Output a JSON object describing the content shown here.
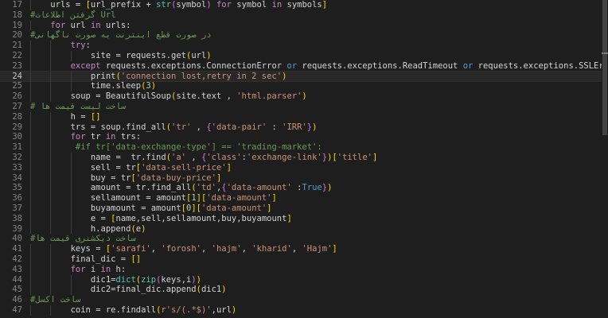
{
  "colors": {
    "background": "#1e1e1e",
    "default": "#d4d4d4",
    "keyword": "#c586c0",
    "string": "#ce9178",
    "function": "#dcdcaa",
    "variable": "#9cdcfe",
    "number": "#b5cea8",
    "comment": "#6a9955",
    "constant": "#569cd6",
    "class": "#4ec9b0",
    "bracket1": "#ffd700",
    "bracket2": "#da70d6",
    "bracket3": "#179fff",
    "line_number": "#858585"
  },
  "current_line": 24,
  "lines": [
    {
      "n": 17,
      "indent": 1,
      "tokens": [
        [
          "urls ",
          "d"
        ],
        [
          "= ",
          "d"
        ],
        [
          "[",
          "b1"
        ],
        [
          "url_prefix ",
          "d"
        ],
        [
          "+ ",
          "d"
        ],
        [
          "str",
          "c"
        ],
        [
          "(",
          "b2"
        ],
        [
          "symbol",
          "d"
        ],
        [
          ")",
          "b2"
        ],
        [
          " for ",
          "k"
        ],
        [
          "symbol ",
          "d"
        ],
        [
          "in ",
          "k"
        ],
        [
          "symbols",
          "d"
        ],
        [
          "]",
          "b1"
        ]
      ]
    },
    {
      "n": 18,
      "indent": 0,
      "tokens": [
        [
          "#گرفتن اطلاعات Url",
          "m"
        ]
      ]
    },
    {
      "n": 19,
      "indent": 1,
      "tokens": [
        [
          "for ",
          "k"
        ],
        [
          "url ",
          "d"
        ],
        [
          "in ",
          "k"
        ],
        [
          "urls",
          "d"
        ],
        [
          ":",
          "d"
        ]
      ]
    },
    {
      "n": 20,
      "indent": 0,
      "tokens": [
        [
          "#در صورت قطع اینترنت به صورت ناگهانی",
          "m"
        ]
      ]
    },
    {
      "n": 21,
      "indent": 2,
      "tokens": [
        [
          "try",
          "k"
        ],
        [
          ":",
          "d"
        ]
      ]
    },
    {
      "n": 22,
      "indent": 3,
      "tokens": [
        [
          "site ",
          "d"
        ],
        [
          "= ",
          "d"
        ],
        [
          "requests.get",
          "d"
        ],
        [
          "(",
          "b1"
        ],
        [
          "url",
          "d"
        ],
        [
          ")",
          "b1"
        ]
      ]
    },
    {
      "n": 23,
      "indent": 2,
      "tokens": [
        [
          "except ",
          "k"
        ],
        [
          "requests.exceptions.ConnectionError ",
          "d"
        ],
        [
          "or ",
          "o"
        ],
        [
          "requests.exceptions.ReadTimeout ",
          "d"
        ],
        [
          "or ",
          "o"
        ],
        [
          "requests.exceptions.SSLError",
          "d"
        ],
        [
          ":",
          "d"
        ]
      ]
    },
    {
      "n": 24,
      "indent": 3,
      "tokens": [
        [
          "print",
          "d"
        ],
        [
          "(",
          "b1"
        ],
        [
          "'connection lost,retry in 2 sec'",
          "s"
        ],
        [
          ")",
          "b1"
        ]
      ]
    },
    {
      "n": 25,
      "indent": 3,
      "tokens": [
        [
          "time.sleep",
          "d"
        ],
        [
          "(",
          "b1"
        ],
        [
          "3",
          "u"
        ],
        [
          ")",
          "b1"
        ]
      ]
    },
    {
      "n": 26,
      "indent": 2,
      "tokens": [
        [
          "soup ",
          "d"
        ],
        [
          "= ",
          "d"
        ],
        [
          "BeautifulSoup",
          "d"
        ],
        [
          "(",
          "b1"
        ],
        [
          "site.text ",
          "d"
        ],
        [
          ", ",
          "d"
        ],
        [
          "'html.parser'",
          "s"
        ],
        [
          ")",
          "b1"
        ]
      ]
    },
    {
      "n": 27,
      "indent": 0,
      "tokens": [
        [
          "# ساخت لیست قیمت ها",
          "m"
        ]
      ]
    },
    {
      "n": 28,
      "indent": 2,
      "tokens": [
        [
          "h ",
          "d"
        ],
        [
          "= ",
          "d"
        ],
        [
          "[]",
          "b1"
        ]
      ]
    },
    {
      "n": 29,
      "indent": 2,
      "tokens": [
        [
          "trs ",
          "d"
        ],
        [
          "= ",
          "d"
        ],
        [
          "soup.find_all",
          "d"
        ],
        [
          "(",
          "b1"
        ],
        [
          "'tr' ",
          "s"
        ],
        [
          ", ",
          "d"
        ],
        [
          "{",
          "b2"
        ],
        [
          "'data-pair' ",
          "s"
        ],
        [
          ": ",
          "d"
        ],
        [
          "'IRR'",
          "s"
        ],
        [
          "}",
          "b2"
        ],
        [
          ")",
          "b1"
        ]
      ]
    },
    {
      "n": 30,
      "indent": 2,
      "tokens": [
        [
          "for ",
          "k"
        ],
        [
          "tr ",
          "d"
        ],
        [
          "in ",
          "k"
        ],
        [
          "trs",
          "d"
        ],
        [
          ":",
          "d"
        ]
      ]
    },
    {
      "n": 31,
      "indent": 2,
      "pre": " ",
      "tokens": [
        [
          "#if tr['data-exchange-type'] == 'trading-market':",
          "m"
        ]
      ]
    },
    {
      "n": 32,
      "indent": 3,
      "tokens": [
        [
          "name ",
          "d"
        ],
        [
          "=  ",
          "d"
        ],
        [
          "tr.find",
          "d"
        ],
        [
          "(",
          "b1"
        ],
        [
          "'a' ",
          "s"
        ],
        [
          ", ",
          "d"
        ],
        [
          "{",
          "b2"
        ],
        [
          "'class'",
          "s"
        ],
        [
          ":",
          "d"
        ],
        [
          "'exchange-link'",
          "s"
        ],
        [
          "}",
          "b2"
        ],
        [
          ")",
          "b1"
        ],
        [
          "[",
          "b1"
        ],
        [
          "'title'",
          "s"
        ],
        [
          "]",
          "b1"
        ]
      ]
    },
    {
      "n": 33,
      "indent": 3,
      "tokens": [
        [
          "sell ",
          "d"
        ],
        [
          "= ",
          "d"
        ],
        [
          "tr",
          "d"
        ],
        [
          "[",
          "b1"
        ],
        [
          "'data-sell-price'",
          "s"
        ],
        [
          "]",
          "b1"
        ]
      ]
    },
    {
      "n": 34,
      "indent": 3,
      "tokens": [
        [
          "buy ",
          "d"
        ],
        [
          "= ",
          "d"
        ],
        [
          "tr",
          "d"
        ],
        [
          "[",
          "b1"
        ],
        [
          "'data-buy-price'",
          "s"
        ],
        [
          "]",
          "b1"
        ]
      ]
    },
    {
      "n": 35,
      "indent": 3,
      "tokens": [
        [
          "amount ",
          "d"
        ],
        [
          "= ",
          "d"
        ],
        [
          "tr.find_all",
          "d"
        ],
        [
          "(",
          "b1"
        ],
        [
          "'td'",
          "s"
        ],
        [
          ",",
          "d"
        ],
        [
          "{",
          "b2"
        ],
        [
          "'data-amount' ",
          "s"
        ],
        [
          ":",
          "d"
        ],
        [
          "True",
          "t"
        ],
        [
          "}",
          "b2"
        ],
        [
          ")",
          "b1"
        ]
      ]
    },
    {
      "n": 36,
      "indent": 3,
      "tokens": [
        [
          "sellamount ",
          "d"
        ],
        [
          "= ",
          "d"
        ],
        [
          "amount",
          "d"
        ],
        [
          "[",
          "b1"
        ],
        [
          "1",
          "u"
        ],
        [
          "]",
          "b1"
        ],
        [
          "[",
          "b1"
        ],
        [
          "'data-amount'",
          "s"
        ],
        [
          "]",
          "b1"
        ]
      ]
    },
    {
      "n": 37,
      "indent": 3,
      "tokens": [
        [
          "buyamount ",
          "d"
        ],
        [
          "= ",
          "d"
        ],
        [
          "amount",
          "d"
        ],
        [
          "[",
          "b1"
        ],
        [
          "0",
          "u"
        ],
        [
          "]",
          "b1"
        ],
        [
          "[",
          "b1"
        ],
        [
          "'data-amount'",
          "s"
        ],
        [
          "]",
          "b1"
        ]
      ]
    },
    {
      "n": 38,
      "indent": 3,
      "tokens": [
        [
          "e ",
          "d"
        ],
        [
          "= ",
          "d"
        ],
        [
          "[",
          "b1"
        ],
        [
          "name,sell,sellamount,buy,buyamount",
          "d"
        ],
        [
          "]",
          "b1"
        ]
      ]
    },
    {
      "n": 39,
      "indent": 3,
      "tokens": [
        [
          "h.append",
          "d"
        ],
        [
          "(",
          "b1"
        ],
        [
          "e",
          "d"
        ],
        [
          ")",
          "b1"
        ]
      ]
    },
    {
      "n": 40,
      "indent": 0,
      "tokens": [
        [
          "#ساخت دیکشنری قیمت ها",
          "m"
        ]
      ]
    },
    {
      "n": 41,
      "indent": 2,
      "tokens": [
        [
          "keys ",
          "d"
        ],
        [
          "= ",
          "d"
        ],
        [
          "[",
          "b1"
        ],
        [
          "'sarafi'",
          "s"
        ],
        [
          ", ",
          "d"
        ],
        [
          "'forosh'",
          "s"
        ],
        [
          ", ",
          "d"
        ],
        [
          "'hajm'",
          "s"
        ],
        [
          ", ",
          "d"
        ],
        [
          "'kharid'",
          "s"
        ],
        [
          ", ",
          "d"
        ],
        [
          "'Hajm'",
          "s"
        ],
        [
          "]",
          "b1"
        ]
      ]
    },
    {
      "n": 42,
      "indent": 2,
      "tokens": [
        [
          "final_dic ",
          "d"
        ],
        [
          "= ",
          "d"
        ],
        [
          "[]",
          "b1"
        ]
      ]
    },
    {
      "n": 43,
      "indent": 2,
      "tokens": [
        [
          "for ",
          "k"
        ],
        [
          "i ",
          "d"
        ],
        [
          "in ",
          "k"
        ],
        [
          "h",
          "d"
        ],
        [
          ":",
          "d"
        ]
      ]
    },
    {
      "n": 44,
      "indent": 3,
      "tokens": [
        [
          "dic1",
          "d"
        ],
        [
          "=",
          "d"
        ],
        [
          "dict",
          "c"
        ],
        [
          "(",
          "b1"
        ],
        [
          "zip",
          "c"
        ],
        [
          "(",
          "b2"
        ],
        [
          "keys,i",
          "d"
        ],
        [
          ")",
          "b2"
        ],
        [
          ")",
          "b1"
        ]
      ]
    },
    {
      "n": 45,
      "indent": 3,
      "tokens": [
        [
          "dic2",
          "d"
        ],
        [
          "=",
          "d"
        ],
        [
          "final_dic.append",
          "d"
        ],
        [
          "(",
          "b1"
        ],
        [
          "dic1",
          "d"
        ],
        [
          ")",
          "b1"
        ]
      ]
    },
    {
      "n": 46,
      "indent": 0,
      "tokens": [
        [
          "#ساخت اکسل",
          "m"
        ]
      ]
    },
    {
      "n": 47,
      "indent": 2,
      "tokens": [
        [
          "coin ",
          "d"
        ],
        [
          "= ",
          "d"
        ],
        [
          "re.findall",
          "d"
        ],
        [
          "(",
          "b1"
        ],
        [
          "r's/(.*$)'",
          "s"
        ],
        [
          ",",
          "d"
        ],
        [
          "url",
          "d"
        ],
        [
          ")",
          "b1"
        ]
      ]
    }
  ]
}
